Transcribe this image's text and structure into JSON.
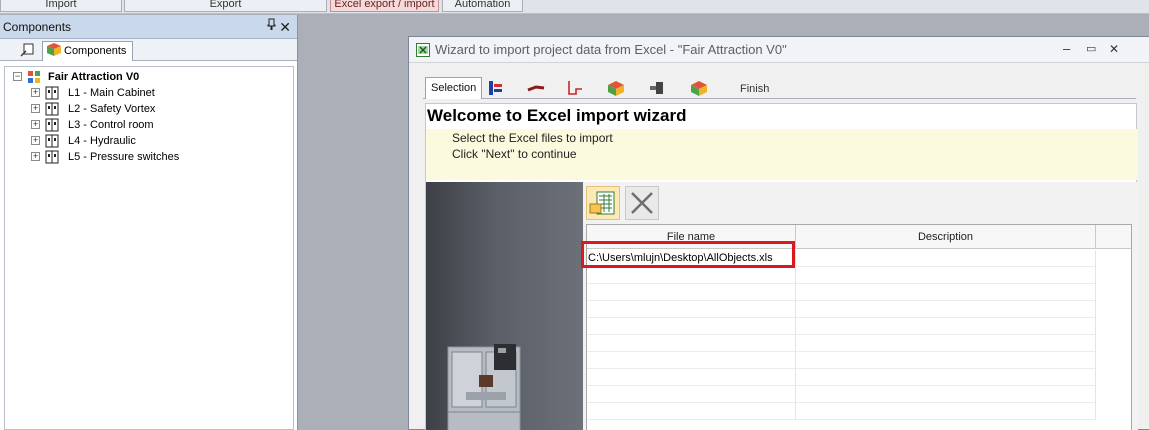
{
  "ribbon": {
    "buttons": [
      "Import",
      "Export",
      "Excel export / import",
      "Automation"
    ]
  },
  "panel": {
    "title": "Components",
    "pin_glyph": "ᵖ",
    "close_glyph": "✕",
    "tab_label": "Components",
    "tree": {
      "root": "Fair Attraction V0",
      "children": [
        "L1 - Main Cabinet",
        "L2 - Safety Vortex",
        "L3 - Control room",
        "L4 - Hydraulic",
        "L5 - Pressure switches"
      ]
    }
  },
  "wizard": {
    "title": "Wizard to import project data from Excel - \"Fair Attraction V0\"",
    "controls": [
      "–",
      "▭",
      "✕"
    ],
    "tabs": {
      "selection": "Selection",
      "finish": "Finish",
      "step_icons": [
        "wiring-icon",
        "cable-icon",
        "pipe-icon",
        "part-cube-icon",
        "connector-icon",
        "part-cube-icon"
      ]
    },
    "heading": "Welcome to Excel import wizard",
    "instructions": [
      "Select the Excel files to import",
      "Click \"Next\" to continue"
    ],
    "toolbar": {
      "add_icon": "add-excel-file-icon",
      "remove_icon": "remove-x-icon"
    },
    "grid": {
      "columns": [
        "File name",
        "Description"
      ],
      "rows": [
        {
          "file": "C:\\Users\\mlujn\\Desktop\\AllObjects.xls",
          "description": ""
        }
      ]
    }
  },
  "colors": {
    "highlight": "#d9191e",
    "instruction_bg": "#fbfadf",
    "panel_title_bg": "#c9d8ea"
  }
}
